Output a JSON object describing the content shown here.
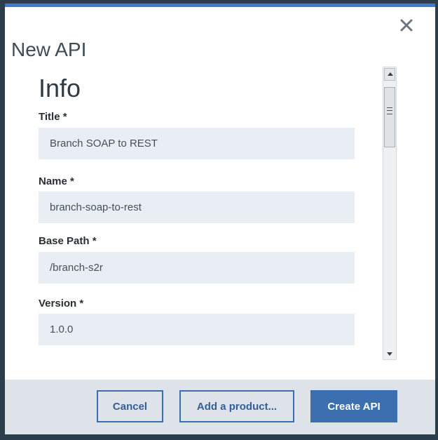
{
  "dialog": {
    "title": "New API",
    "close_icon": "close-icon",
    "accent_color": "#3f7bd1"
  },
  "info": {
    "section_title": "Info",
    "fields": [
      {
        "label": "Title *",
        "value": "Branch SOAP to REST"
      },
      {
        "label": "Name *",
        "value": "branch-soap-to-rest"
      },
      {
        "label": "Base Path *",
        "value": "/branch-s2r"
      },
      {
        "label": "Version *",
        "value": "1.0.0"
      }
    ]
  },
  "footer": {
    "cancel_label": "Cancel",
    "add_product_label": "Add a product...",
    "create_label": "Create API",
    "primary_color": "#3b6fb0"
  }
}
